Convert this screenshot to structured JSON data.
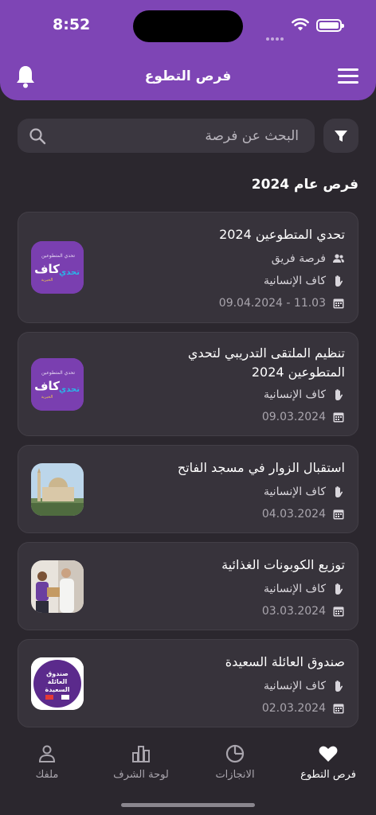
{
  "status": {
    "time": "8:52"
  },
  "header": {
    "title": "فرص التطوع"
  },
  "search": {
    "placeholder": "البحث عن فرصة"
  },
  "section": {
    "title": "فرص عام 2024"
  },
  "cards": [
    {
      "title": "تحدي المتطوعين 2024",
      "type": "فرصة فريق",
      "org": "كاف الإنسانية",
      "date": "11.03 - 09.04.2024",
      "thumb": "kaaf-logo"
    },
    {
      "title": "تنظيم الملتقى التدريبي لتحدي المتطوعين 2024",
      "org": "كاف الإنسانية",
      "date": "09.03.2024",
      "thumb": "kaaf-logo"
    },
    {
      "title": "استقبال الزوار في مسجد الفاتح",
      "org": "كاف الإنسانية",
      "date": "04.03.2024",
      "thumb": "mosque-photo"
    },
    {
      "title": "توزيع الكوبونات الغذائية",
      "org": "كاف الإنسانية",
      "date": "03.03.2024",
      "thumb": "delivery-photo"
    },
    {
      "title": "صندوق العائلة السعيدة",
      "org": "كاف الإنسانية",
      "date": "02.03.2024",
      "thumb": "happy-family-box"
    }
  ],
  "thumb_text": {
    "kaaf": "كاف",
    "kaaf_sub": "الخيرية",
    "tahadi_small": "تحدي المتطوعين",
    "tahadi": "تحدي",
    "box_line1": "صندوق",
    "box_line2": "العائلة",
    "box_line3": "السعيدة"
  },
  "nav": [
    {
      "label": "فرص التطوع",
      "icon": "heart-icon",
      "active": true
    },
    {
      "label": "الانجازات",
      "icon": "pie-chart-icon",
      "active": false
    },
    {
      "label": "لوحة الشرف",
      "icon": "leaderboard-icon",
      "active": false
    },
    {
      "label": "ملفك",
      "icon": "user-icon",
      "active": false
    }
  ],
  "colors": {
    "accent": "#7e45b5",
    "background": "#2b272e",
    "card": "#37333b"
  }
}
